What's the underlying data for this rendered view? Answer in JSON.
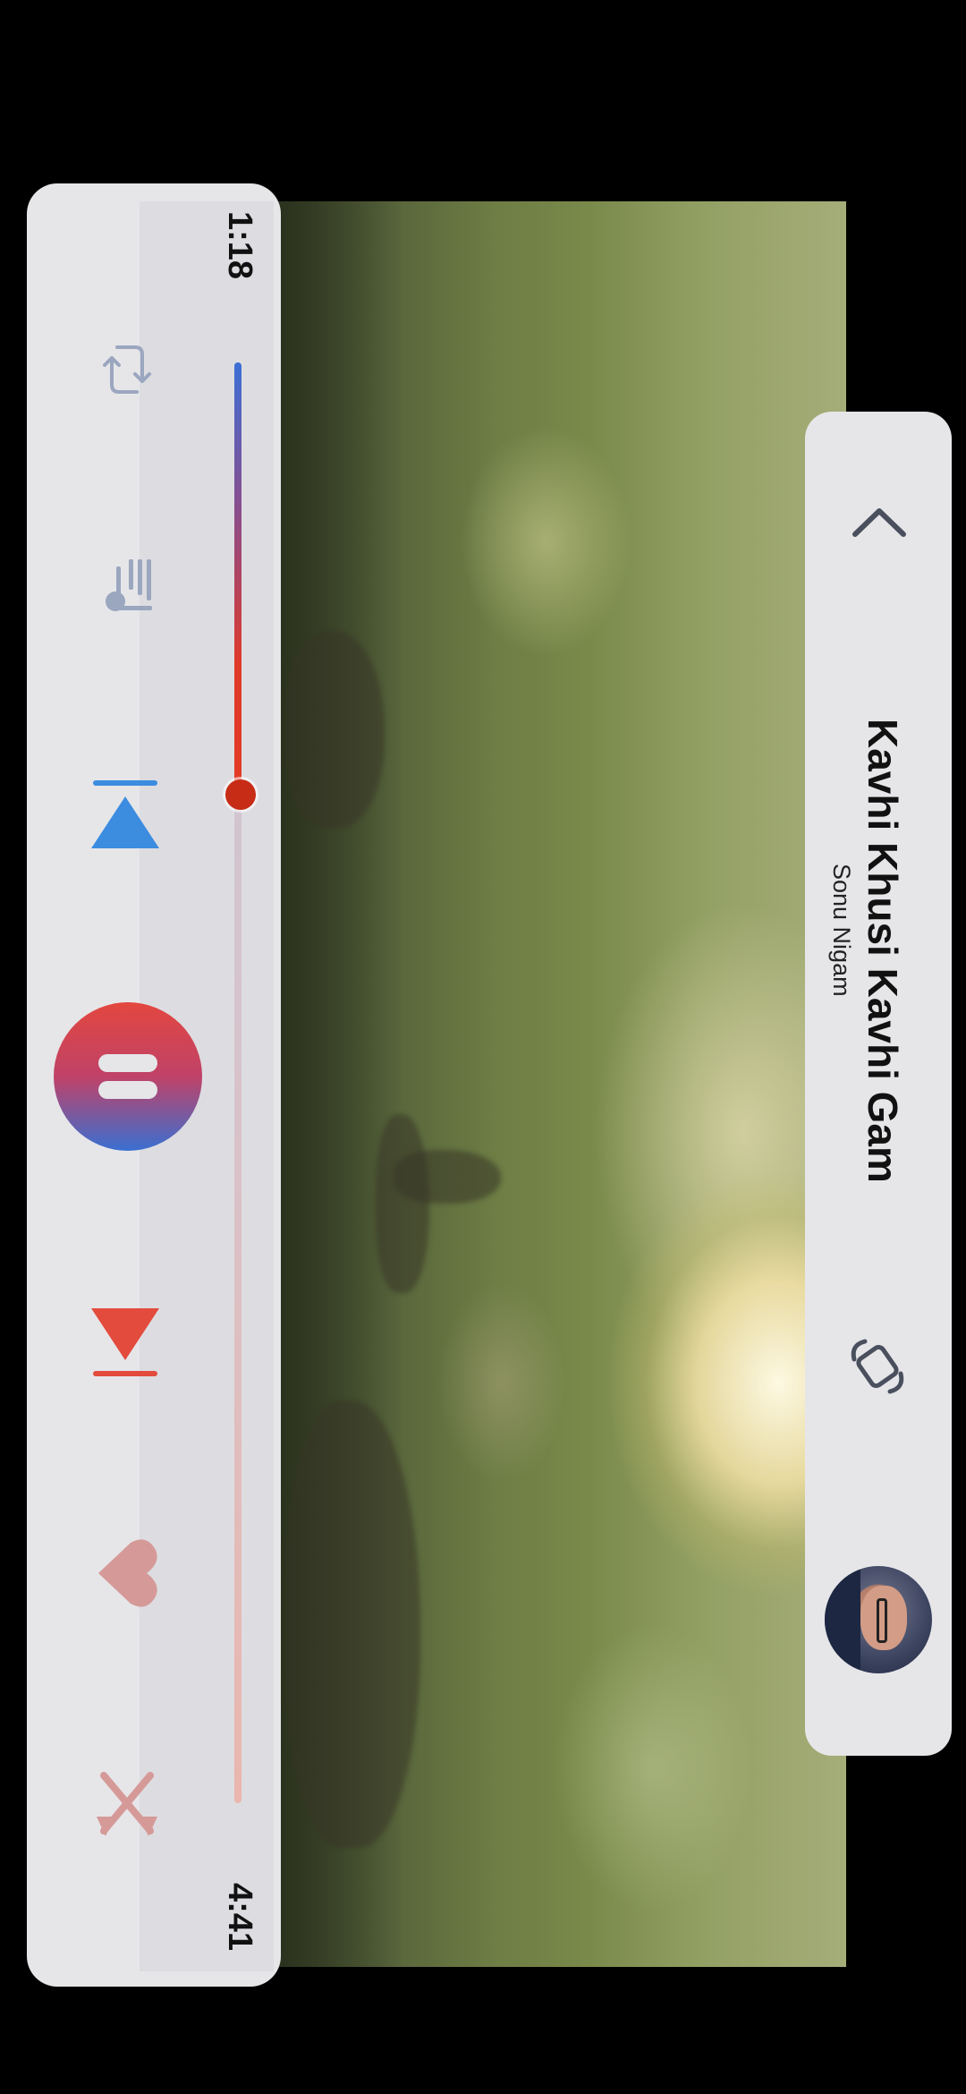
{
  "player": {
    "current_time": "1:18",
    "total_time": "4:41",
    "progress": 0.3,
    "accent_start": "#3c6fd6",
    "accent_end": "#e23b25"
  },
  "track": {
    "title": "Kavhi Khusi Kavhi Gam",
    "artist": "Sonu Nigam"
  },
  "controls": {
    "icons": [
      "repeat-icon",
      "queue-icon",
      "previous-icon",
      "pause-icon",
      "next-icon",
      "heart-icon",
      "shuffle-icon"
    ]
  },
  "info_card": {
    "icons": [
      "chevron-up-icon",
      "rotate-screen-icon",
      "avatar"
    ]
  }
}
